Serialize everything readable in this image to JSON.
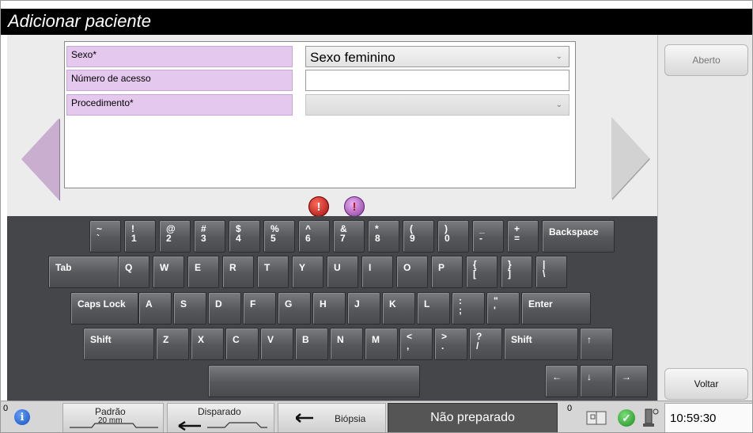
{
  "window": {
    "title": "Adicionar paciente"
  },
  "form": {
    "fields": [
      {
        "label": "Sexo*",
        "value": "Sexo feminino",
        "type": "select"
      },
      {
        "label": "Número de acesso",
        "value": "",
        "type": "text"
      },
      {
        "label": "Procedimento*",
        "value": "",
        "type": "select-disabled"
      }
    ]
  },
  "keyboard": {
    "row1": [
      {
        "top": "~",
        "bottom": "`"
      },
      {
        "top": "!",
        "bottom": "1"
      },
      {
        "top": "@",
        "bottom": "2"
      },
      {
        "top": "#",
        "bottom": "3"
      },
      {
        "top": "$",
        "bottom": "4"
      },
      {
        "top": "%",
        "bottom": "5"
      },
      {
        "top": "^",
        "bottom": "6"
      },
      {
        "top": "&",
        "bottom": "7"
      },
      {
        "top": "*",
        "bottom": "8"
      },
      {
        "top": "(",
        "bottom": "9"
      },
      {
        "top": ")",
        "bottom": "0"
      },
      {
        "top": "_",
        "bottom": "-"
      },
      {
        "top": "+",
        "bottom": "="
      },
      {
        "label": "Backspace"
      }
    ],
    "row2": [
      {
        "label": "Tab"
      },
      {
        "label": "Q"
      },
      {
        "label": "W"
      },
      {
        "label": "E"
      },
      {
        "label": "R"
      },
      {
        "label": "T"
      },
      {
        "label": "Y"
      },
      {
        "label": "U"
      },
      {
        "label": "I"
      },
      {
        "label": "O"
      },
      {
        "label": "P"
      },
      {
        "top": "{",
        "bottom": "["
      },
      {
        "top": "}",
        "bottom": "]"
      },
      {
        "top": "|",
        "bottom": "\\"
      }
    ],
    "row3": [
      {
        "label": "Caps Lock"
      },
      {
        "label": "A"
      },
      {
        "label": "S"
      },
      {
        "label": "D"
      },
      {
        "label": "F"
      },
      {
        "label": "G"
      },
      {
        "label": "H"
      },
      {
        "label": "J"
      },
      {
        "label": "K"
      },
      {
        "label": "L"
      },
      {
        "top": ":",
        "bottom": ";"
      },
      {
        "top": "\"",
        "bottom": "'"
      },
      {
        "label": "Enter"
      }
    ],
    "row4": [
      {
        "label": "Shift"
      },
      {
        "label": "Z"
      },
      {
        "label": "X"
      },
      {
        "label": "C"
      },
      {
        "label": "V"
      },
      {
        "label": "B"
      },
      {
        "label": "N"
      },
      {
        "label": "M"
      },
      {
        "top": "<",
        "bottom": ","
      },
      {
        "top": ">",
        "bottom": "."
      },
      {
        "top": "?",
        "bottom": "/"
      },
      {
        "label": "Shift"
      },
      {
        "label": "↑"
      }
    ],
    "row5": [
      {
        "label": ""
      },
      {
        "label": "←"
      },
      {
        "label": "↓"
      },
      {
        "label": "→"
      }
    ]
  },
  "side": {
    "open_label": "Aberto",
    "back_label": "Voltar"
  },
  "statusbar": {
    "left_count": "0",
    "preset_label": "Padrão",
    "preset_sub": "20 mm",
    "trigger_label": "Disparado",
    "biopsy_label": "Biópsia",
    "status_text": "Não preparado",
    "right_count": "0",
    "time": "10:59:30"
  },
  "colors": {
    "label_bg": "#e4c8ee",
    "keyboard_bg": "#454649",
    "title_bg": "#000000"
  }
}
